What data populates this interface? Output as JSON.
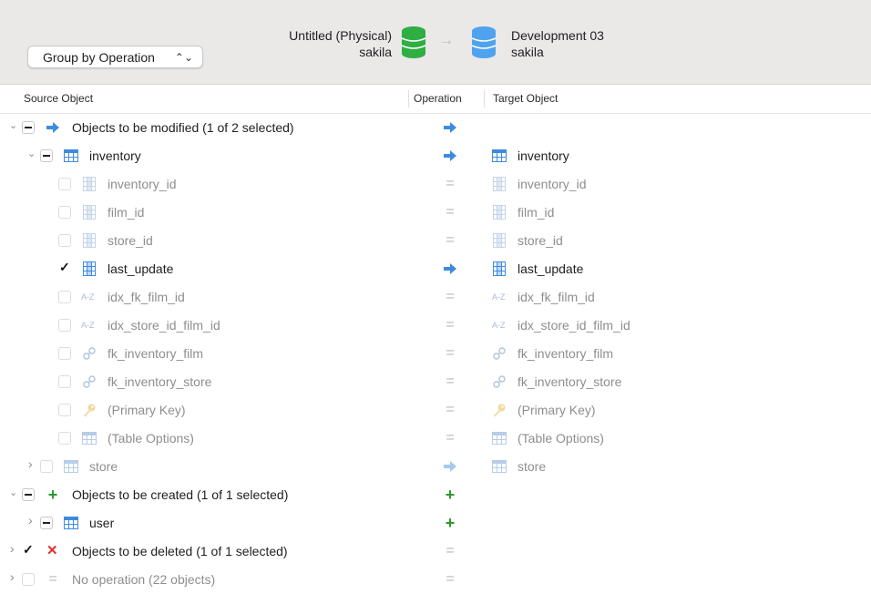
{
  "toolbar": {
    "group_select_label": "Group by Operation",
    "group_select_chevron": "⌃⌄",
    "source_connection": {
      "name": "Untitled (Physical)",
      "schema": "sakila",
      "icon": "database-icon",
      "color": "#28a745"
    },
    "target_connection": {
      "name": "Development 03",
      "schema": "sakila",
      "icon": "database-icon",
      "color": "#4a9be8"
    },
    "arrow": "→"
  },
  "columns": {
    "source": "Source Object",
    "operation": "Operation",
    "target": "Target Object"
  },
  "groups": {
    "modified": {
      "label": "Objects to be modified (1 of 2 selected)"
    },
    "created": {
      "label": "Objects to be created (1 of 1 selected)"
    },
    "deleted": {
      "label": "Objects to be deleted (1 of 1 selected)"
    },
    "noop": {
      "label": "No operation (22 objects)"
    }
  },
  "items": {
    "inventory": "inventory",
    "inventory_id": "inventory_id",
    "film_id": "film_id",
    "store_id": "store_id",
    "last_update": "last_update",
    "idx_fk_film_id": "idx_fk_film_id",
    "idx_store_id_film_id": "idx_store_id_film_id",
    "fk_inventory_film": "fk_inventory_film",
    "fk_inventory_store": "fk_inventory_store",
    "primary_key": "(Primary Key)",
    "table_options": "(Table Options)",
    "store": "store",
    "user": "user"
  },
  "glyphs": {
    "equals": "=",
    "plus": "+",
    "cross": "✕",
    "az": "A-Z",
    "disclosure_open": "⌄",
    "disclosure_closed": "›"
  },
  "colors": {
    "accent_blue": "#3d8be0",
    "add_green": "#2a9a2a",
    "delete_red": "#e03030"
  }
}
